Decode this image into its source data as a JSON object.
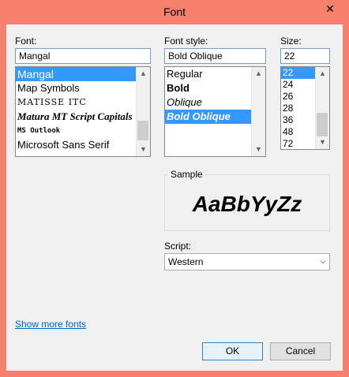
{
  "window": {
    "title": "Font",
    "close_glyph": "✕"
  },
  "font": {
    "label": "Font:",
    "value": "Mangal",
    "items": [
      "Mangal",
      "Map Symbols",
      "MATISSE ITC",
      "Matura MT Script Capitals",
      "MS Outlook",
      "Microsoft Sans Serif"
    ],
    "selected_index": 0
  },
  "style": {
    "label": "Font style:",
    "value": "Bold Oblique",
    "items": [
      "Regular",
      "Bold",
      "Oblique",
      "Bold Oblique"
    ],
    "selected_index": 3
  },
  "size": {
    "label": "Size:",
    "value": "22",
    "items": [
      "22",
      "24",
      "26",
      "28",
      "36",
      "48",
      "72"
    ],
    "selected_index": 0
  },
  "sample": {
    "label": "Sample",
    "text": "AaBbYyZz"
  },
  "script": {
    "label": "Script:",
    "value": "Western"
  },
  "show_more": "Show more fonts",
  "buttons": {
    "ok": "OK",
    "cancel": "Cancel"
  },
  "icons": {
    "scroll_up": "scroll-up-arrow",
    "scroll_down": "scroll-down-arrow",
    "dropdown": "chevron-down"
  },
  "colors": {
    "frame": "#f8816d",
    "selection": "#3399ff",
    "link": "#0066cc"
  }
}
